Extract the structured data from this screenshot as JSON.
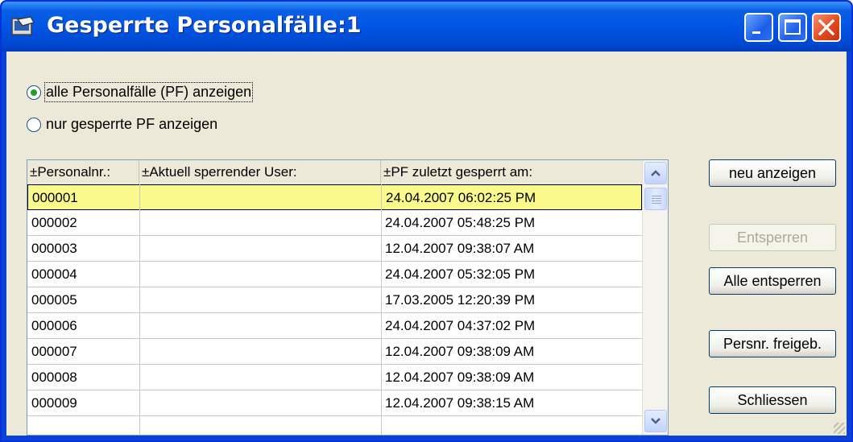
{
  "window": {
    "title": "Gesperrte Personalfälle:1",
    "controls": [
      "minimize-icon",
      "maximize-icon",
      "close-icon"
    ],
    "accent_color": "#0055e5",
    "close_color": "#e0461e"
  },
  "filter": {
    "options": [
      {
        "label": "alle Personalfälle (PF) anzeigen",
        "selected": true
      },
      {
        "label": "nur gesperrte PF anzeigen",
        "selected": false
      }
    ]
  },
  "table": {
    "columns": [
      "±Personalnr.:",
      "±Aktuell sperrender User:",
      "±PF zuletzt gesperrt am:"
    ],
    "rows": [
      {
        "personalnr": "000001",
        "user": "",
        "gesperrt_am": "24.04.2007 06:02:25 PM",
        "selected": true
      },
      {
        "personalnr": "000002",
        "user": "",
        "gesperrt_am": "24.04.2007 05:48:25 PM"
      },
      {
        "personalnr": "000003",
        "user": "",
        "gesperrt_am": "12.04.2007 09:38:07 AM"
      },
      {
        "personalnr": "000004",
        "user": "",
        "gesperrt_am": "24.04.2007 05:32:05 PM"
      },
      {
        "personalnr": "000005",
        "user": "",
        "gesperrt_am": "17.03.2005 12:20:39 PM"
      },
      {
        "personalnr": "000006",
        "user": "",
        "gesperrt_am": "24.04.2007 04:37:02 PM"
      },
      {
        "personalnr": "000007",
        "user": "",
        "gesperrt_am": "12.04.2007 09:38:09 AM"
      },
      {
        "personalnr": "000008",
        "user": "",
        "gesperrt_am": "12.04.2007 09:38:09 AM"
      },
      {
        "personalnr": "000009",
        "user": "",
        "gesperrt_am": "12.04.2007 09:38:15 AM"
      }
    ],
    "selected_row_color": "#fafa8c"
  },
  "buttons": {
    "neu_anzeigen": "neu anzeigen",
    "entsperren": "Entsperren",
    "alle_entsperren": "Alle entsperren",
    "persnr_freigeben": "Persnr. freigeb.",
    "schliessen": "Schliessen"
  }
}
